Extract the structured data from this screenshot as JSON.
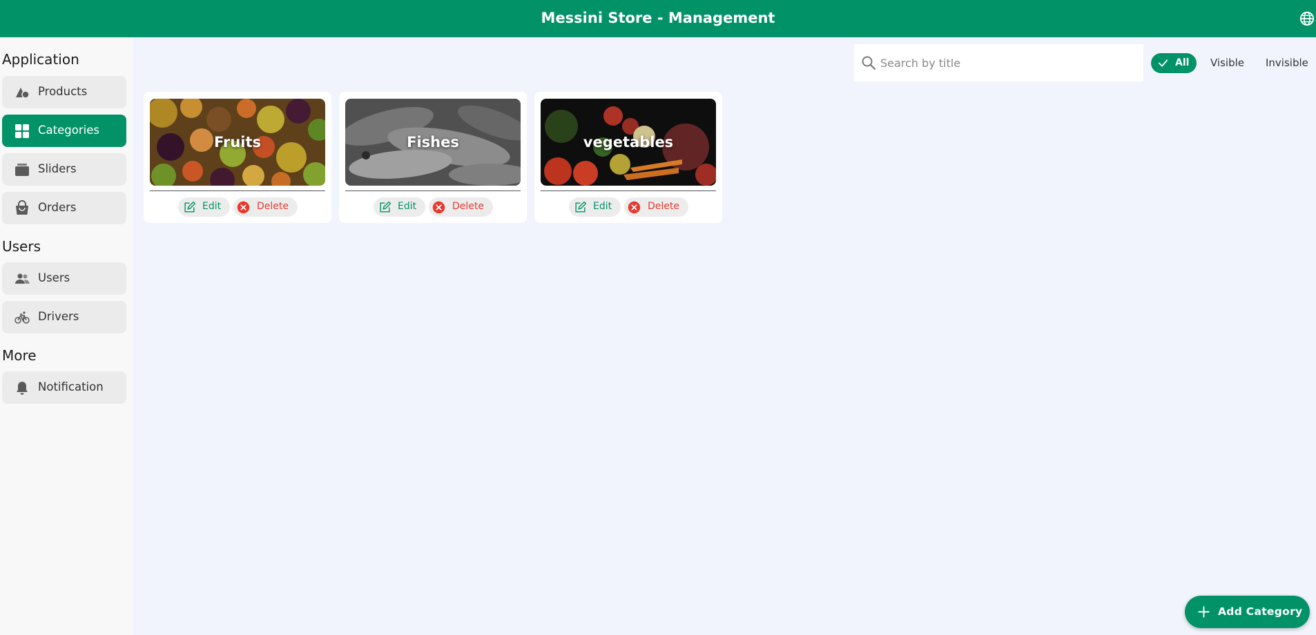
{
  "header": {
    "title": "Messini Store - Management",
    "language_icon": "globe-icon"
  },
  "colors": {
    "primary": "#019267",
    "danger": "#e63a2e",
    "background": "#f1f4fc",
    "sidebar": "#f8f8f8"
  },
  "sidebar": {
    "sections": [
      {
        "title": "Application",
        "items": [
          {
            "label": "Products",
            "icon": "shapes-icon"
          },
          {
            "label": "Categories",
            "icon": "grid-icon",
            "active": true
          },
          {
            "label": "Sliders",
            "icon": "stack-icon"
          },
          {
            "label": "Orders",
            "icon": "shopping-bag-icon"
          }
        ]
      },
      {
        "title": "Users",
        "items": [
          {
            "label": "Users",
            "icon": "people-icon"
          },
          {
            "label": "Drivers",
            "icon": "bicycle-icon"
          }
        ]
      },
      {
        "title": "More",
        "items": [
          {
            "label": "Notification",
            "icon": "bell-icon"
          }
        ]
      }
    ]
  },
  "search": {
    "placeholder": "Search by title",
    "value": ""
  },
  "filters": {
    "options": [
      "All",
      "Visible",
      "Invisible"
    ],
    "selected": "All"
  },
  "categories": [
    {
      "name": "Fruits",
      "edit_label": "Edit",
      "delete_label": "Delete"
    },
    {
      "name": "Fishes",
      "edit_label": "Edit",
      "delete_label": "Delete"
    },
    {
      "name": "vegetables",
      "edit_label": "Edit",
      "delete_label": "Delete"
    }
  ],
  "fab": {
    "label": "Add Category",
    "icon": "plus-icon"
  }
}
